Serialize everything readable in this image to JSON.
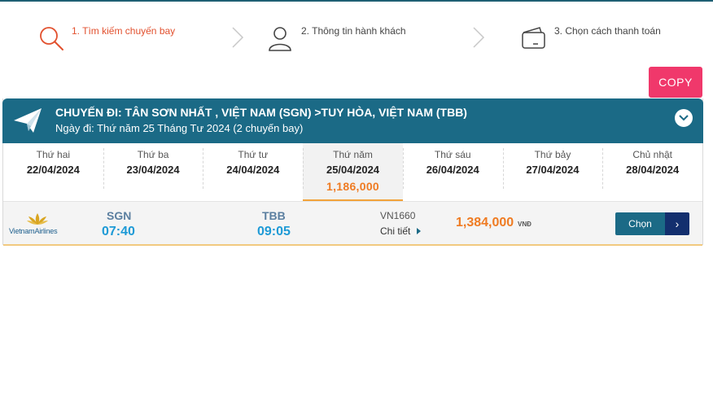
{
  "steps": [
    {
      "label": "1. Tìm kiếm chuyến bay",
      "icon": "search-icon",
      "active": true
    },
    {
      "label": "2. Thông tin hành khách",
      "icon": "user-icon",
      "active": false
    },
    {
      "label": "3. Chọn cách thanh toán",
      "icon": "wallet-icon",
      "active": false
    }
  ],
  "copy_label": "COPY",
  "route": {
    "title": "CHUYẾN ĐI: TÂN SƠN NHẤT , VIỆT NAM (SGN) >TUY HÒA, VIỆT NAM (TBB)",
    "date_line": "Ngày đi: Thứ năm 25 Tháng Tư 2024 (2 chuyến bay)"
  },
  "date_tabs": [
    {
      "dow": "Thứ hai",
      "date": "22/04/2024",
      "price": ""
    },
    {
      "dow": "Thứ ba",
      "date": "23/04/2024",
      "price": ""
    },
    {
      "dow": "Thứ tư",
      "date": "24/04/2024",
      "price": ""
    },
    {
      "dow": "Thứ năm",
      "date": "25/04/2024",
      "price": "1,186,000"
    },
    {
      "dow": "Thứ sáu",
      "date": "26/04/2024",
      "price": ""
    },
    {
      "dow": "Thứ bảy",
      "date": "27/04/2024",
      "price": ""
    },
    {
      "dow": "Chủ nhật",
      "date": "28/04/2024",
      "price": ""
    }
  ],
  "selected_tab_index": 3,
  "flight": {
    "airline": "Vietnam Airlines",
    "logo_text": "VietnamAirlines",
    "from_code": "SGN",
    "depart_time": "07:40",
    "to_code": "TBB",
    "arrive_time": "09:05",
    "flight_no": "VN1660",
    "detail_label": "Chi tiết",
    "fare": "1,384,000",
    "currency": "VNĐ",
    "choose_label": "Chọn",
    "choose_arrow": "›"
  },
  "colors": {
    "header_teal": "#1b6a86",
    "accent_orange": "#ef7b22",
    "copy_pink": "#f0386b",
    "time_blue": "#1e9ad6",
    "active_step": "#e2512f"
  }
}
